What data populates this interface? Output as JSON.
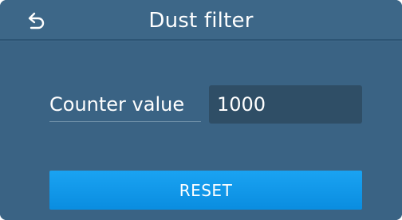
{
  "header": {
    "back_icon": "back-arrow-icon",
    "title": "Dust filter"
  },
  "counter": {
    "label": "Counter value",
    "value": "1000"
  },
  "actions": {
    "reset_label": "RESET"
  },
  "colors": {
    "background": "#3a6384",
    "field": "#2f4e66",
    "accent": "#0a8de0"
  }
}
